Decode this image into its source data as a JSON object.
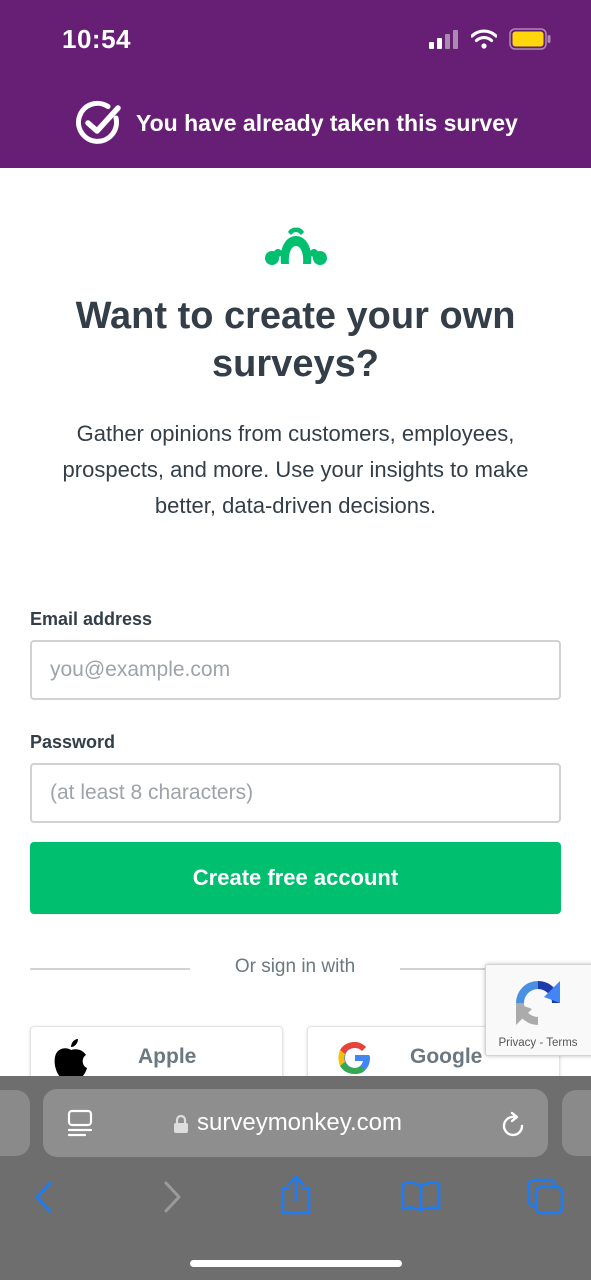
{
  "status_bar": {
    "time": "10:54"
  },
  "banner": {
    "text": "You have already taken this survey"
  },
  "hero": {
    "headline": "Want to create your own surveys?",
    "subtitle": "Gather opinions from customers, employees, prospects, and more. Use your insights to make better, data-driven decisions."
  },
  "form": {
    "email_label": "Email address",
    "email_placeholder": "you@example.com",
    "password_label": "Password",
    "password_placeholder": "(at least 8 characters)",
    "submit_label": "Create free account"
  },
  "social": {
    "divider_text": "Or sign in with",
    "apple_label": "Apple",
    "google_label": "Google"
  },
  "recaptcha": {
    "privacy": "Privacy",
    "separator": "-",
    "terms": "Terms"
  },
  "browser": {
    "url": "surveymonkey.com"
  },
  "colors": {
    "header": "#671e75",
    "primary": "#00bf6f",
    "text": "#333e48",
    "battery": "#ffd60a"
  },
  "icons": [
    "signal-icon",
    "wifi-icon",
    "battery-icon",
    "checkmark-circle-icon",
    "surveymonkey-logo-icon",
    "apple-icon",
    "google-icon",
    "recaptcha-icon",
    "reader-icon",
    "lock-icon",
    "reload-icon",
    "back-icon",
    "forward-icon",
    "share-icon",
    "bookmarks-icon",
    "tabs-icon"
  ]
}
